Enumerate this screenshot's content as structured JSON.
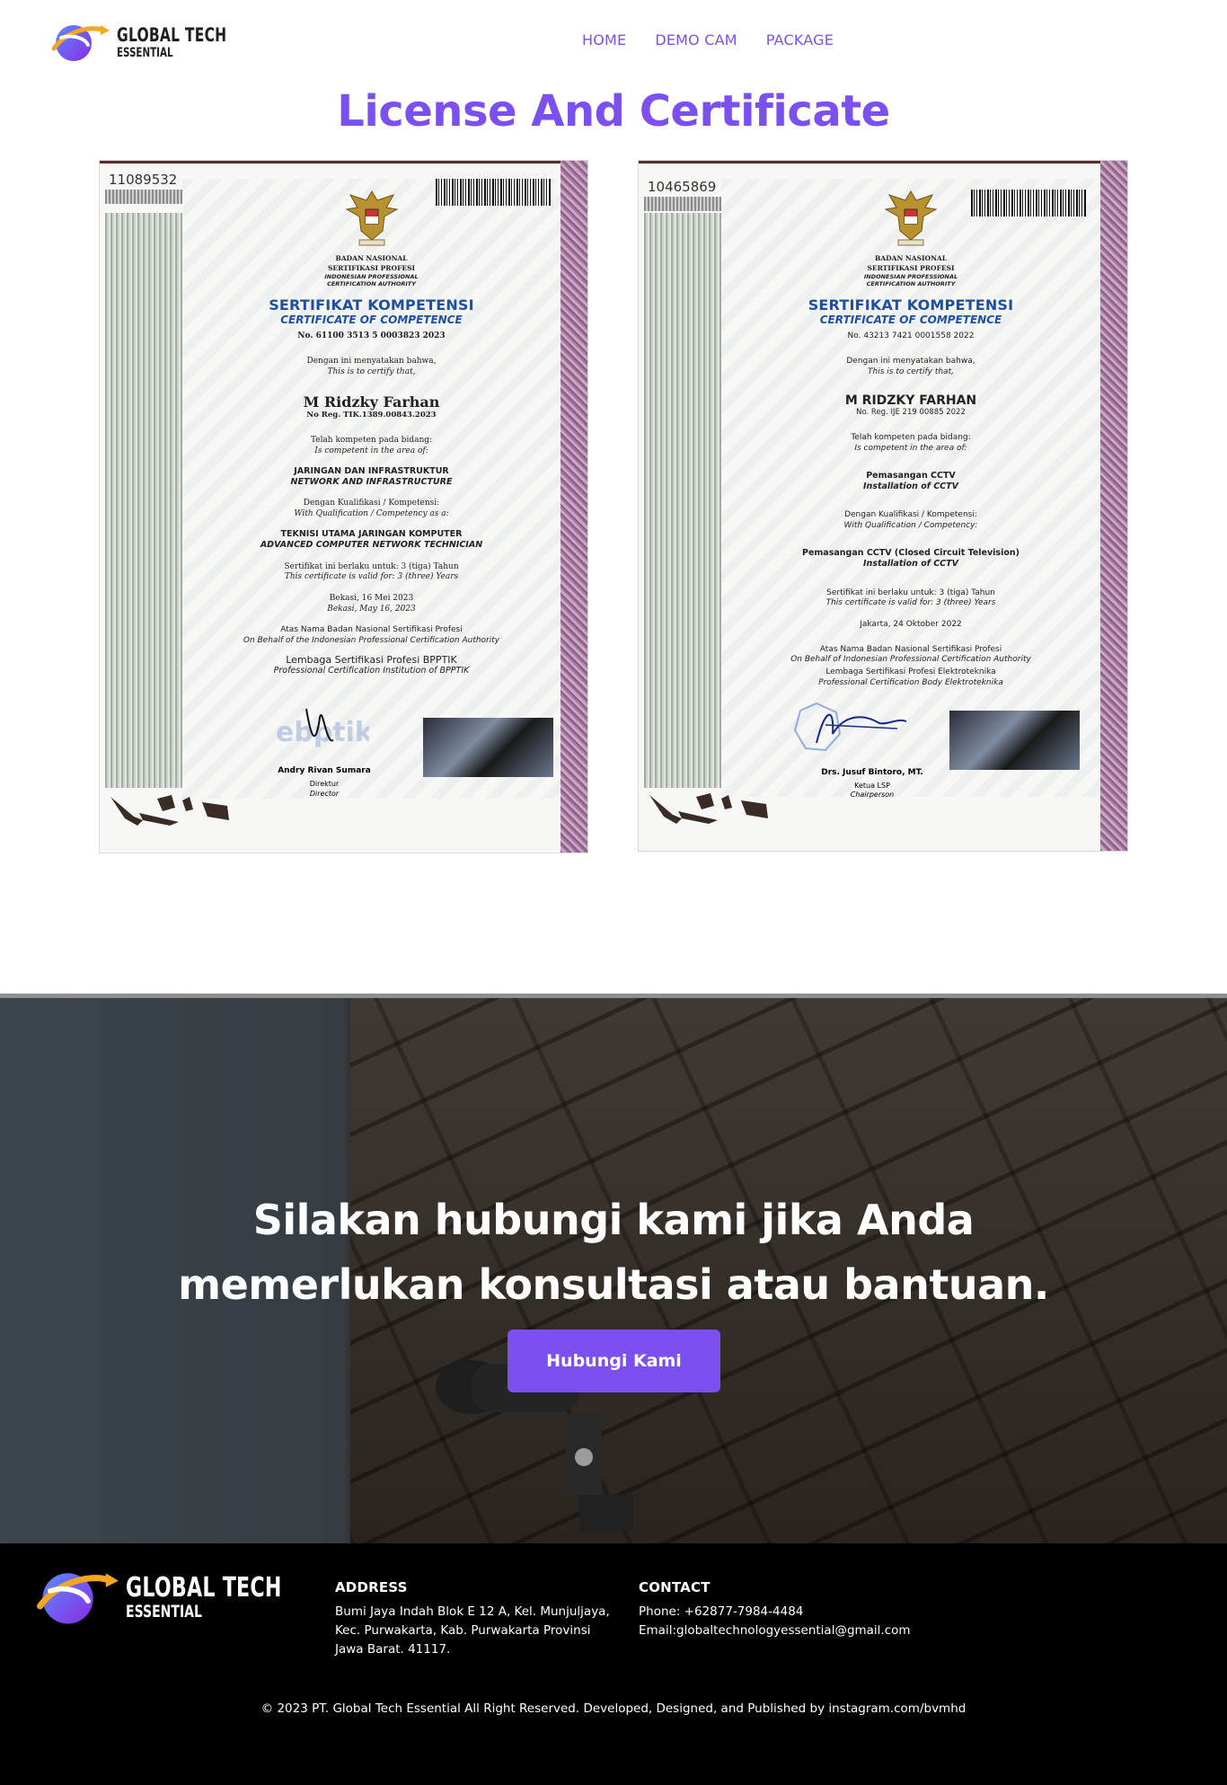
{
  "brand": {
    "line1": "GLOBAL TECH",
    "line2": "ESSENTIAL"
  },
  "nav": [
    {
      "label": "HOME"
    },
    {
      "label": "DEMO CAM"
    },
    {
      "label": "PACKAGE"
    }
  ],
  "colors": {
    "accent": "#7b4ff0",
    "footer_bg": "#000000",
    "text_dark": "#1f1f1f"
  },
  "certificates_section": {
    "title": "License And Certificate"
  },
  "certificates": [
    {
      "serial": "11089532",
      "authority_line1": "BADAN NASIONAL",
      "authority_line2": "SERTIFIKASI PROFESI",
      "authority_en1": "INDONESIAN PROFESSIONAL",
      "authority_en2": "CERTIFICATION AUTHORITY",
      "title_id": "SERTIFIKAT KOMPETENSI",
      "title_en": "CERTIFICATE OF COMPETENCE",
      "number": "No. 61100 3513 5 0003823 2023",
      "certify_id": "Dengan ini menyatakan bahwa,",
      "certify_en": "This is to certify that,",
      "holder": "M Ridzky Farhan",
      "reg": "No Reg. TIK.1389.00843.2023",
      "competent_id": "Telah kompeten pada bidang:",
      "competent_en": "Is competent in the area of:",
      "area_id": "JARINGAN DAN INFRASTRUKTUR",
      "area_en": "NETWORK AND INFRASTRUCTURE",
      "qual_id": "Dengan Kualifikasi / Kompetensi:",
      "qual_en": "With Qualification / Competency as a:",
      "qualification_id": "TEKNISI UTAMA JARINGAN KOMPUTER",
      "qualification_en": "ADVANCED COMPUTER NETWORK TECHNICIAN",
      "valid_id": "Sertifikat ini berlaku untuk: 3 (tiga) Tahun",
      "valid_en": "This certificate is valid for: 3 (three) Years",
      "place_date_id": "Bekasi, 16 Mei 2023",
      "place_date_en": "Bekasi, May 16, 2023",
      "behalf_id": "Atas Nama Badan Nasional Sertifikasi Profesi",
      "behalf_en": "On Behalf of the Indonesian Professional Certification Authority",
      "lsp_id": "Lembaga Sertifikasi Profesi BPPTIK",
      "lsp_en": "Professional Certification Institution of BPPTIK",
      "signer": "Andry Rivan Sumara",
      "role_id": "Direktur",
      "role_en": "Director"
    },
    {
      "serial": "10465869",
      "authority_line1": "BADAN NASIONAL",
      "authority_line2": "SERTIFIKASI PROFESI",
      "authority_en1": "INDONESIAN PROFESSIONAL",
      "authority_en2": "CERTIFICATION AUTHORITY",
      "title_id": "SERTIFIKAT KOMPETENSI",
      "title_en": "CERTIFICATE OF COMPETENCE",
      "number": "No. 43213 7421 0001558 2022",
      "certify_id": "Dengan ini menyatakan bahwa,",
      "certify_en": "This is to certify that,",
      "holder": "M RIDZKY FARHAN",
      "reg": "No. Reg. IJE 219 00885 2022",
      "competent_id": "Telah kompeten pada bidang:",
      "competent_en": "Is competent in the area of:",
      "area_id": "Pemasangan CCTV",
      "area_en": "Installation of CCTV",
      "qual_id": "Dengan Kualifikasi / Kompetensi:",
      "qual_en": "With Qualification / Competency:",
      "qualification_id": "Pemasangan CCTV (Closed Circuit Television)",
      "qualification_en": "Installation of CCTV",
      "valid_id": "Sertifikat ini berlaku untuk:   3 (tiga) Tahun",
      "valid_en": "This certificate is valid for:   3 (three) Years",
      "place_date_id": "Jakarta, 24 Oktober 2022",
      "place_date_en": "",
      "behalf_id": "Atas Nama Badan Nasional Sertifikasi Profesi",
      "behalf_en": "On Behalf of Indonesian Professional Certification Authority",
      "lsp_id": "Lembaga Sertifikasi Profesi Elektroteknika",
      "lsp_en": "Professional Certification Body Elektroteknika",
      "signer": "Drs. Jusuf Bintoro, MT.",
      "role_id": "Ketua LSP",
      "role_en": "Chairperson"
    }
  ],
  "cta": {
    "heading_line1": "Silakan hubungi kami jika Anda",
    "heading_line2": "memerlukan konsultasi atau bantuan.",
    "button": "Hubungi Kami"
  },
  "footer": {
    "address_title": "ADDRESS",
    "address_line1": "Bumi Jaya Indah Blok E 12 A, Kel. Munjuljaya,",
    "address_line2": "Kec. Purwakarta, Kab. Purwakarta Provinsi",
    "address_line3": "Jawa Barat. 41117.",
    "contact_title": "CONTACT",
    "phone": "Phone: +62877-7984-4484",
    "email": "Email:globaltechnologyessential@gmail.com",
    "copyright": "© 2023 PT. Global Tech Essential All Right Reserved. Developed, Designed, and Published by instagram.com/bvmhd"
  }
}
